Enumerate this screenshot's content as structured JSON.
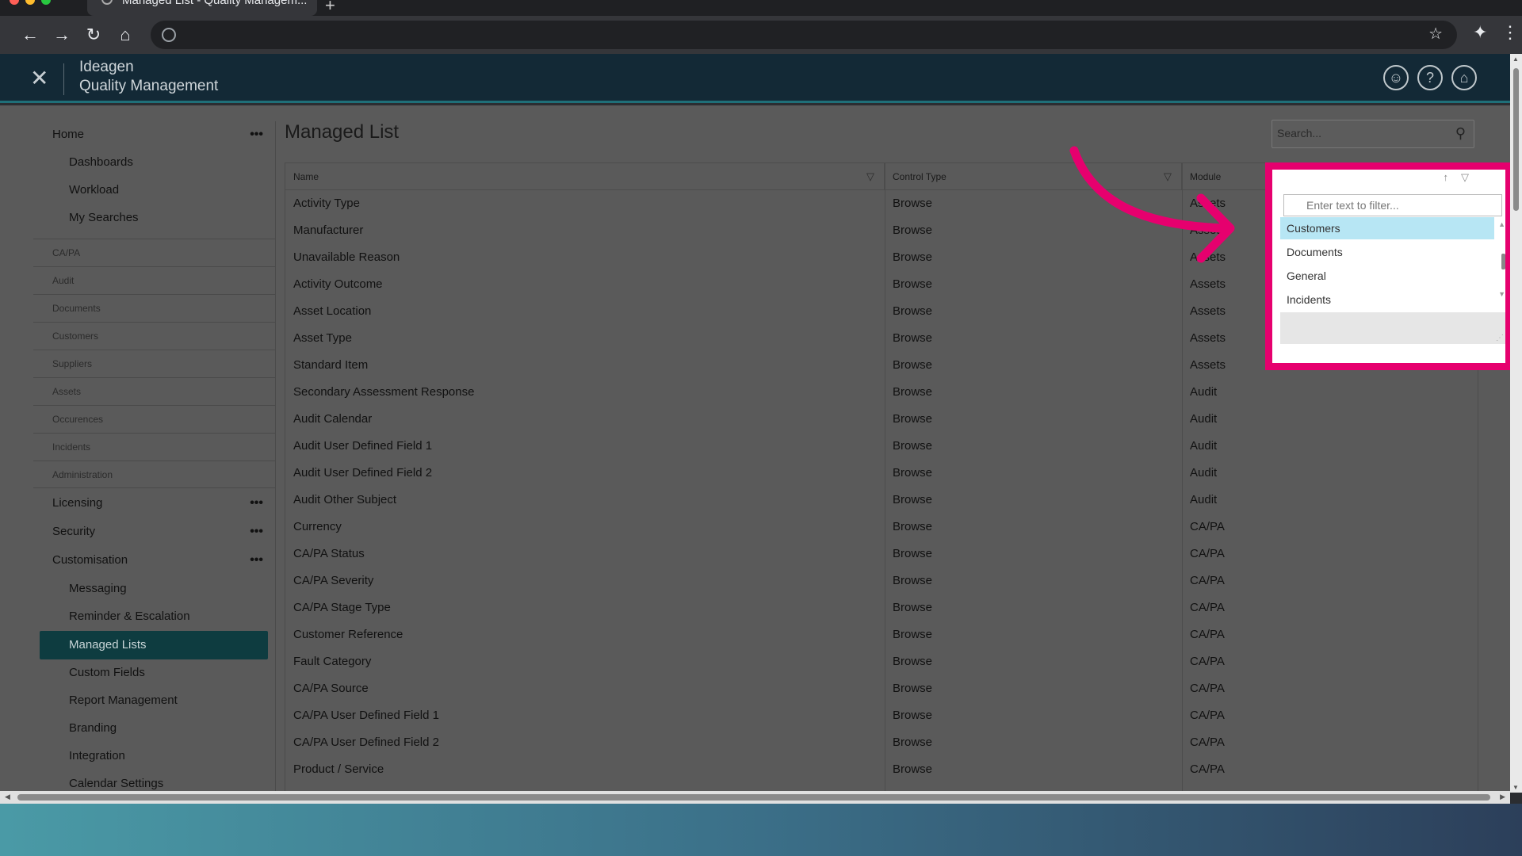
{
  "browser": {
    "tab_title": "Managed List - Quality Managem..."
  },
  "app": {
    "brand_line1": "Ideagen",
    "brand_line2": "Quality Management"
  },
  "sidebar": {
    "home": "Home",
    "home_children": [
      "Dashboards",
      "Workload",
      "My Searches"
    ],
    "sections": [
      "CA/PA",
      "Audit",
      "Documents",
      "Customers",
      "Suppliers",
      "Assets",
      "Occurences",
      "Incidents",
      "Administration"
    ],
    "licensing": "Licensing",
    "security": "Security",
    "customisation": "Customisation",
    "customisation_children": [
      "Messaging",
      "Reminder & Escalation",
      "Managed Lists",
      "Custom Fields",
      "Report Management",
      "Branding",
      "Integration",
      "Calendar Settings"
    ],
    "active_item": "Managed Lists"
  },
  "main": {
    "title": "Managed List",
    "search_placeholder": "Search..."
  },
  "grid": {
    "columns": [
      "Name",
      "Control Type",
      "Module"
    ],
    "rows": [
      [
        "Activity Type",
        "Browse",
        "Assets"
      ],
      [
        "Manufacturer",
        "Browse",
        "Assets"
      ],
      [
        "Unavailable Reason",
        "Browse",
        "Assets"
      ],
      [
        "Activity Outcome",
        "Browse",
        "Assets"
      ],
      [
        "Asset Location",
        "Browse",
        "Assets"
      ],
      [
        "Asset Type",
        "Browse",
        "Assets"
      ],
      [
        "Standard Item",
        "Browse",
        "Assets"
      ],
      [
        "Secondary Assessment Response",
        "Browse",
        "Audit"
      ],
      [
        "Audit Calendar",
        "Browse",
        "Audit"
      ],
      [
        "Audit User Defined Field 1",
        "Browse",
        "Audit"
      ],
      [
        "Audit User Defined Field 2",
        "Browse",
        "Audit"
      ],
      [
        "Audit Other Subject",
        "Browse",
        "Audit"
      ],
      [
        "Currency",
        "Browse",
        "CA/PA"
      ],
      [
        "CA/PA Status",
        "Browse",
        "CA/PA"
      ],
      [
        "CA/PA Severity",
        "Browse",
        "CA/PA"
      ],
      [
        "CA/PA Stage Type",
        "Browse",
        "CA/PA"
      ],
      [
        "Customer Reference",
        "Browse",
        "CA/PA"
      ],
      [
        "Fault Category",
        "Browse",
        "CA/PA"
      ],
      [
        "CA/PA Source",
        "Browse",
        "CA/PA"
      ],
      [
        "CA/PA User Defined Field 1",
        "Browse",
        "CA/PA"
      ],
      [
        "CA/PA User Defined Field 2",
        "Browse",
        "CA/PA"
      ],
      [
        "Product / Service",
        "Browse",
        "CA/PA"
      ]
    ]
  },
  "popup": {
    "filter_placeholder": "Enter text to filter...",
    "options": [
      "Customers",
      "Documents",
      "General",
      "Incidents"
    ],
    "selected": "Customers"
  },
  "colors": {
    "highlight_frame": "#e6006e",
    "active_nav": "#0e3c40",
    "header_bg": "#132936"
  }
}
